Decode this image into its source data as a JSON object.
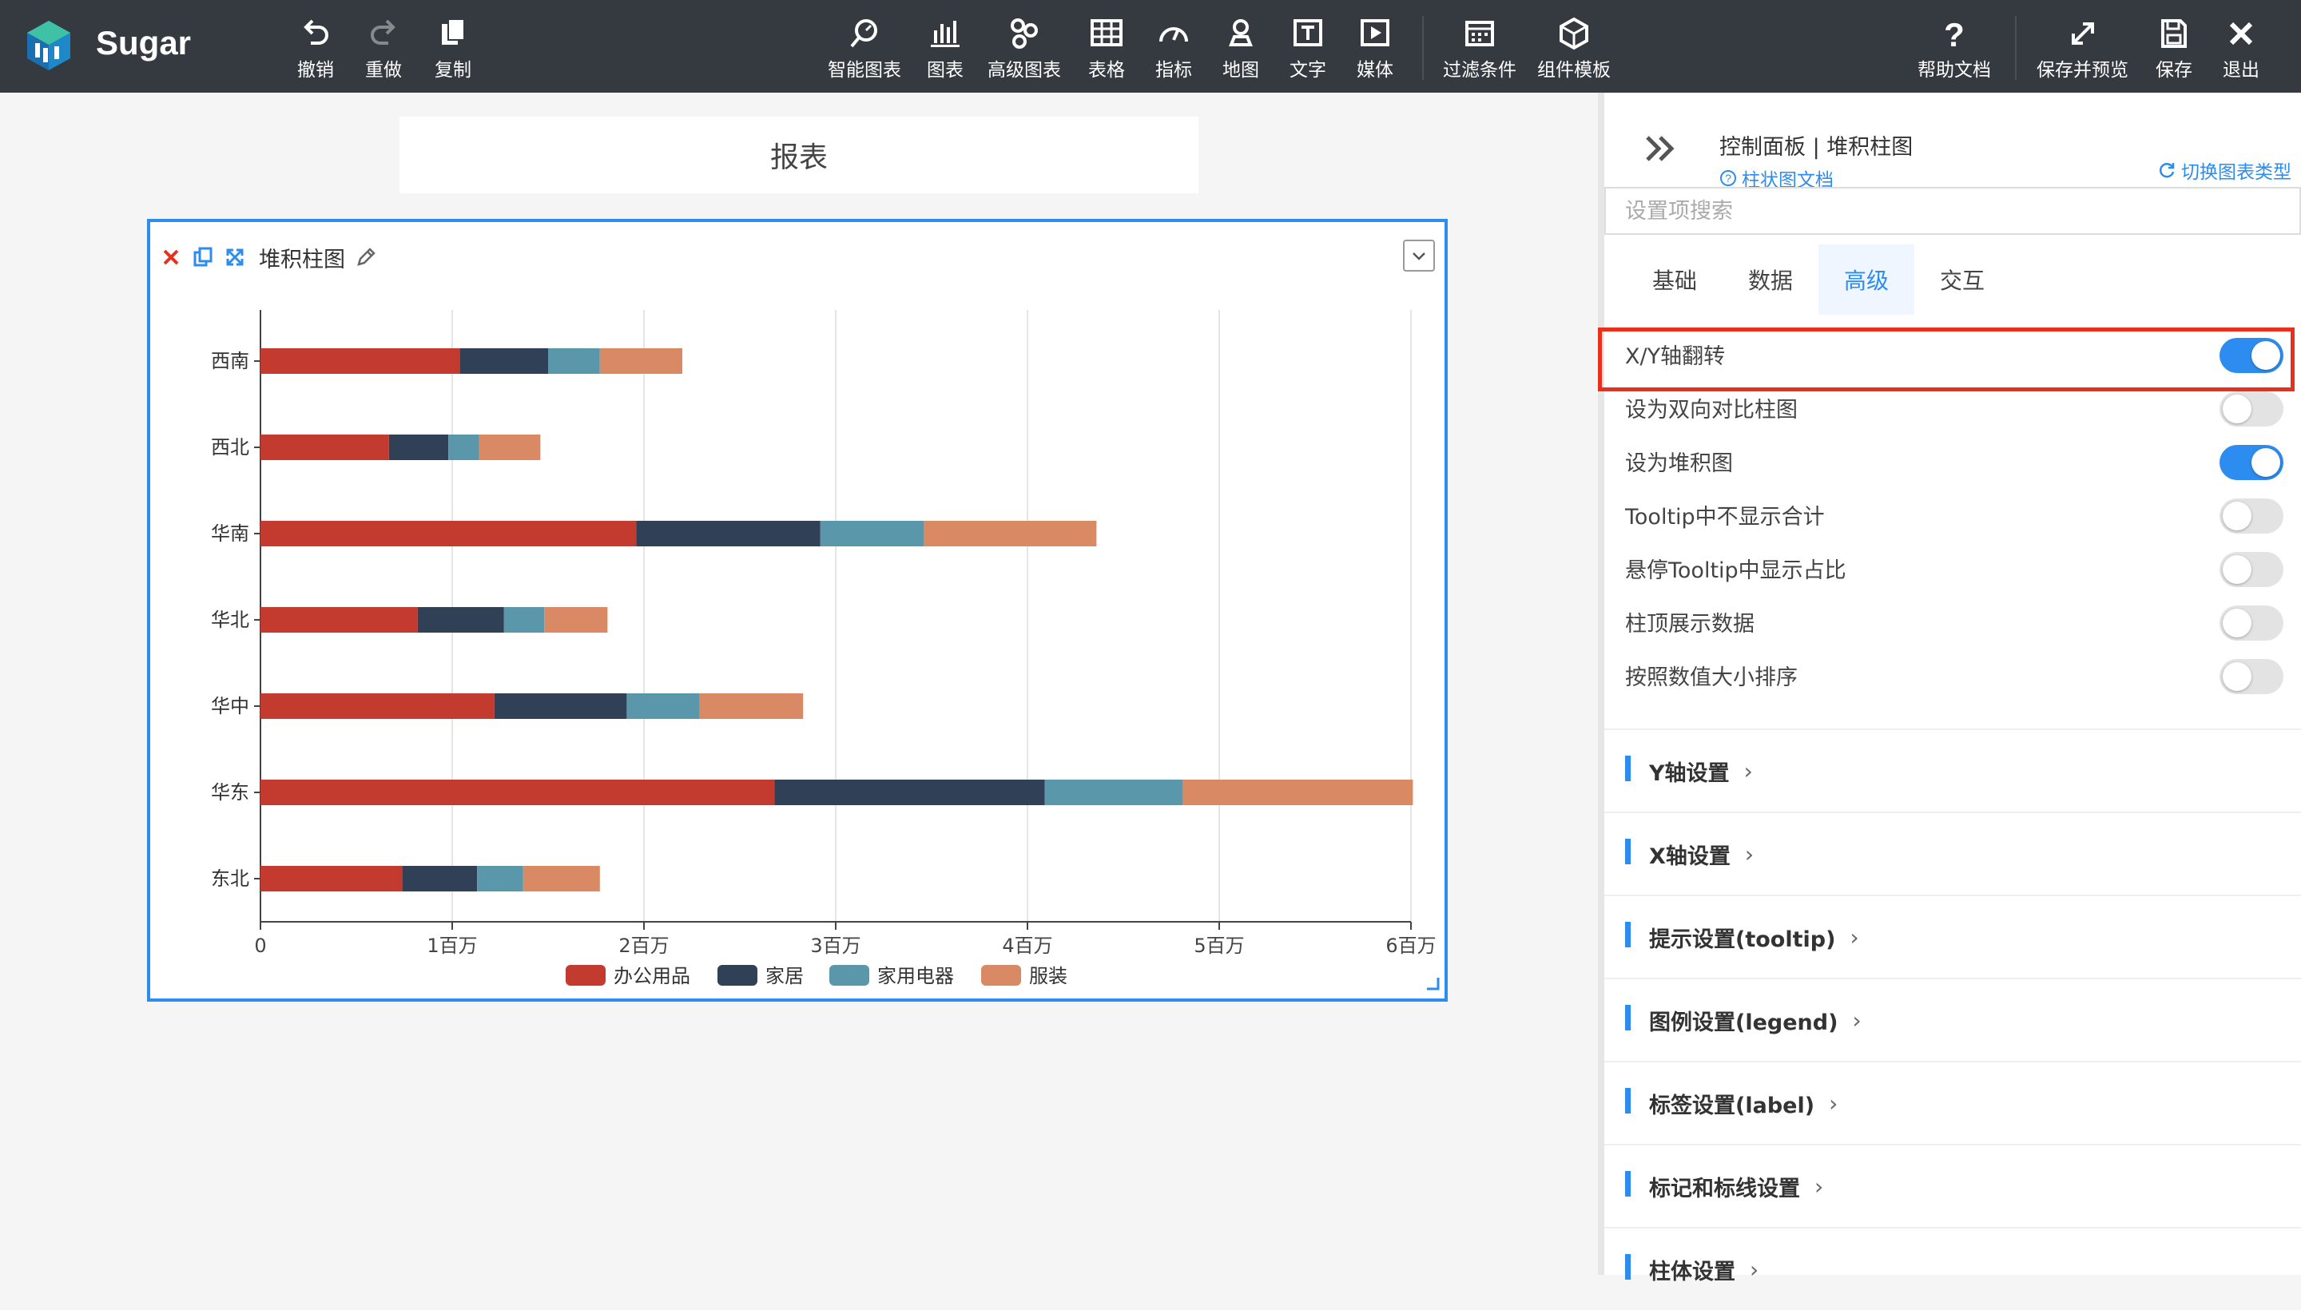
{
  "app": {
    "name": "Sugar"
  },
  "toolbar": {
    "left": [
      {
        "label": "撤销",
        "icon": "undo-icon"
      },
      {
        "label": "重做",
        "icon": "redo-icon"
      },
      {
        "label": "复制",
        "icon": "copy-icon"
      }
    ],
    "center": [
      {
        "label": "智能图表",
        "icon": "smart-chart-icon"
      },
      {
        "label": "图表",
        "icon": "bar-chart-icon"
      },
      {
        "label": "高级图表",
        "icon": "advanced-chart-icon"
      },
      {
        "label": "表格",
        "icon": "table-icon"
      },
      {
        "label": "指标",
        "icon": "gauge-icon"
      },
      {
        "label": "地图",
        "icon": "map-pin-icon"
      },
      {
        "label": "文字",
        "icon": "text-icon"
      },
      {
        "label": "媒体",
        "icon": "media-icon"
      },
      {
        "label": "过滤条件",
        "icon": "filter-calendar-icon"
      },
      {
        "label": "组件模板",
        "icon": "template-icon"
      }
    ],
    "right": [
      {
        "label": "帮助文档",
        "icon": "help-icon"
      },
      {
        "label": "保存并预览",
        "icon": "expand-icon"
      },
      {
        "label": "保存",
        "icon": "save-icon"
      },
      {
        "label": "退出",
        "icon": "close-icon"
      }
    ]
  },
  "report": {
    "title": "报表"
  },
  "card": {
    "title": "堆积柱图"
  },
  "chart_data": {
    "type": "bar",
    "orientation": "horizontal",
    "stacked": true,
    "categories": [
      "西南",
      "西北",
      "华南",
      "华北",
      "华中",
      "华东",
      "东北"
    ],
    "series": [
      {
        "name": "办公用品",
        "values": [
          1040000,
          670000,
          1960000,
          820000,
          1220000,
          2680000,
          740000
        ],
        "color": "#c23b2e"
      },
      {
        "name": "家居",
        "values": [
          460000,
          310000,
          960000,
          450000,
          690000,
          1410000,
          390000
        ],
        "color": "#2f4057"
      },
      {
        "name": "家用电器",
        "values": [
          270000,
          160000,
          540000,
          210000,
          380000,
          720000,
          240000
        ],
        "color": "#5b97ab"
      },
      {
        "name": "服装",
        "values": [
          430000,
          320000,
          900000,
          330000,
          540000,
          1200000,
          400000
        ],
        "color": "#d98a64"
      }
    ],
    "xlim": [
      0,
      6000000
    ],
    "xticks": [
      "0",
      "1百万",
      "2百万",
      "3百万",
      "4百万",
      "5百万",
      "6百万"
    ],
    "grid": "vertical",
    "legend": "bottom-center"
  },
  "panel": {
    "title": "控制面板 | 堆积柱图",
    "doc_link": "柱状图文档",
    "switch_link": "切换图表类型",
    "search_placeholder": "设置项搜索",
    "tabs": [
      {
        "label": "基础",
        "active": false
      },
      {
        "label": "数据",
        "active": false
      },
      {
        "label": "高级",
        "active": true
      },
      {
        "label": "交互",
        "active": false
      }
    ],
    "settings": [
      {
        "label": "X/Y轴翻转",
        "on": true
      },
      {
        "label": "设为双向对比柱图",
        "on": false
      },
      {
        "label": "设为堆积图",
        "on": true
      },
      {
        "label": "Tooltip中不显示合计",
        "on": false
      },
      {
        "label": "悬停Tooltip中显示占比",
        "on": false
      },
      {
        "label": "柱顶展示数据",
        "on": false
      },
      {
        "label": "按照数值大小排序",
        "on": false
      }
    ],
    "sections": [
      "Y轴设置",
      "X轴设置",
      "提示设置(tooltip)",
      "图例设置(legend)",
      "标签设置(label)",
      "标记和标线设置",
      "柱体设置"
    ]
  }
}
